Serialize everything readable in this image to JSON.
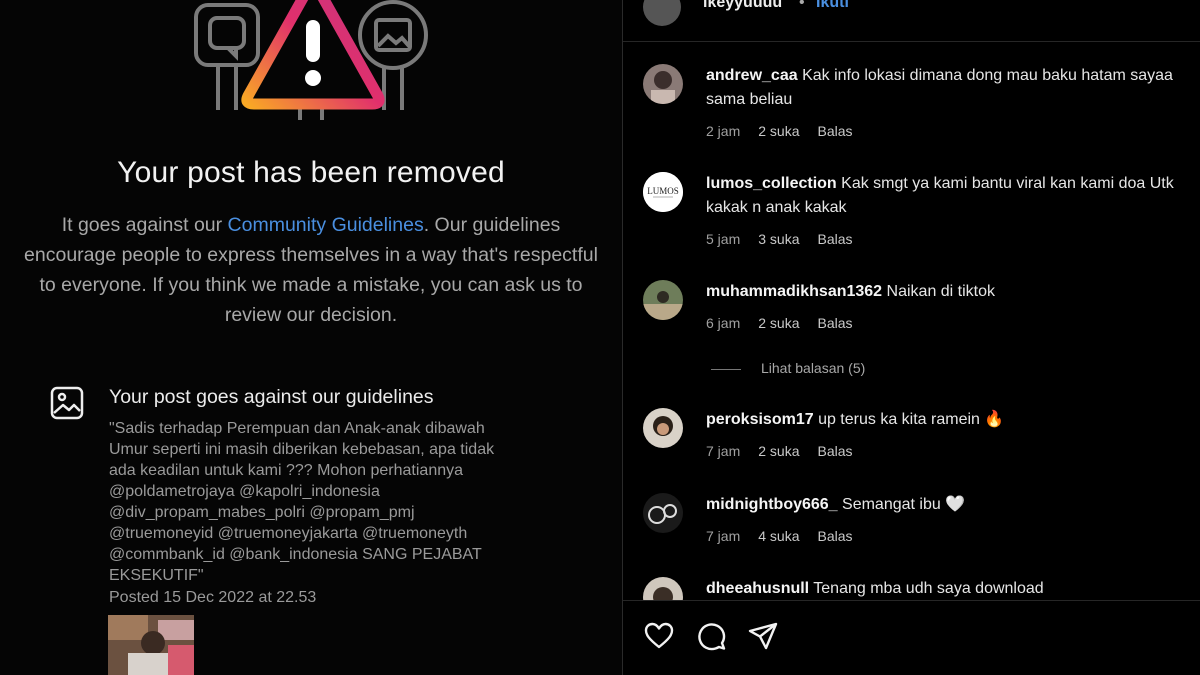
{
  "removed": {
    "title": "Your post has been removed",
    "explain_before": "It goes against our ",
    "explain_link": "Community Guidelines",
    "explain_after": ". Our guidelines encourage people to express themselves in a way that's respectful to everyone. If you think we made a mistake, you can ask us to review our decision."
  },
  "post": {
    "section_title": "Your post goes against our guidelines",
    "quote": "\"Sadis terhadap Perempuan dan Anak-anak dibawah\nUmur seperti ini masih diberikan kebebasan, apa tidak\nada keadilan untuk kami ??? Mohon perhatiannya\n@poldametrojaya @kapolri_indonesia\n@div_propam_mabes_polri @propam_pmj\n@truemoneyid @truemoneyjakarta @truemoneyth\n@commbank_id @bank_indonesia SANG PEJABAT\nEKSEKUTIF\"",
    "posted": "Posted 15 Dec 2022 at 22.53"
  },
  "header": {
    "username": "ikeyyuuuu",
    "dot": "•",
    "follow": "Ikuti"
  },
  "comments": [
    {
      "user": "andrew_caa",
      "text": "Kak info lokasi dimana dong mau baku hatam sayaa sama beliau",
      "time": "2 jam",
      "likes": "2 suka",
      "reply": "Balas"
    },
    {
      "user": "lumos_collection",
      "text": "Kak smgt ya kami bantu viral kan kami doa Utk kakak n anak kakak",
      "time": "5 jam",
      "likes": "3 suka",
      "reply": "Balas"
    },
    {
      "user": "muhammadikhsan1362",
      "text": "Naikan di tiktok",
      "time": "6 jam",
      "likes": "2 suka",
      "reply": "Balas"
    },
    {
      "user": "peroksisom17",
      "text": "up terus ka kita ramein 🔥",
      "time": "7 jam",
      "likes": "2 suka",
      "reply": "Balas"
    },
    {
      "user": "midnightboy666_",
      "text": "Semangat ibu 🤍",
      "time": "7 jam",
      "likes": "4 suka",
      "reply": "Balas"
    },
    {
      "user": "dheeahusnull",
      "text": "Tenang mba udh saya download"
    }
  ],
  "view_replies": "Lihat balasan (5)",
  "avatar_logo_text": "LUMOS",
  "icons": [
    "heart-icon",
    "comment-icon",
    "share-icon",
    "image-icon",
    "warning-icon"
  ],
  "colors": {
    "link": "#4a8fe0",
    "warning_gradient": [
      "#f9a825",
      "#e1306c",
      "#c13584"
    ]
  }
}
